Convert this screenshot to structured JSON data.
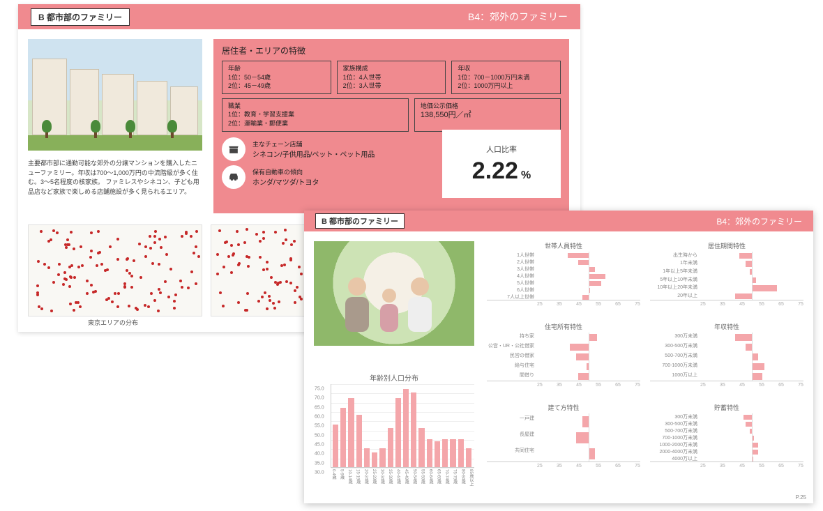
{
  "slide1": {
    "title_box": "B 都市部のファミリー",
    "subtitle": "B4：郊外のファミリー",
    "desc": "主要都市部に通勤可能な郊外の分譲マンションを購入したニューファミリー。年収は700～1,000万円の中流階級が多く住む。3～5名程度の核家族。\nファミレスやシネコン、子ども用品店など家族で楽しめる店舗施設が多く見られるエリア。",
    "features_heading": "居住者・エリアの特徴",
    "age": {
      "label": "年齢",
      "l1": "1位：50－54歳",
      "l2": "2位：45－49歳"
    },
    "family": {
      "label": "家族構成",
      "l1": "1位：4人世帯",
      "l2": "2位：3人世帯"
    },
    "income": {
      "label": "年収",
      "l1": "1位：700－1000万円未満",
      "l2": "2位：1000万円以上"
    },
    "job": {
      "label": "職業",
      "l1": "1位：教育・学習支援業",
      "l2": "2位：運輸業・郵便業"
    },
    "land": {
      "label": "地価公示価格",
      "value": "138,550円／㎡"
    },
    "chain_label": "主なチェーン店舗",
    "chain_value": "シネコン/子供用品/ペット・ペット用品",
    "car_label": "保有自動車の傾向",
    "car_value": "ホンダ/マツダ/トヨタ",
    "pop_label": "人口比率",
    "pop_value": "2.22",
    "pop_unit": "%",
    "map_caption_left": "東京エリアの分布"
  },
  "slide2": {
    "title_box": "B 都市部のファミリー",
    "subtitle": "B4：郊外のファミリー",
    "page": "P.25"
  },
  "chart_data": {
    "age_distribution": {
      "type": "bar",
      "title": "年齢別人口分布",
      "categories": [
        "0-4歳",
        "5-9歳",
        "10-14歳",
        "15-19歳",
        "20-24歳",
        "25-29歳",
        "30-34歳",
        "35-39歳",
        "40-44歳",
        "45-49歳",
        "50-54歳",
        "55-59歳",
        "60-64歳",
        "65-69歳",
        "70-74歳",
        "75-79歳",
        "80-84歳",
        "85歳以上"
      ],
      "values": [
        53,
        62,
        67,
        58,
        40,
        38,
        40,
        51,
        67,
        72,
        70,
        51,
        45,
        44,
        45,
        45,
        45,
        40
      ],
      "ylim": [
        30,
        75
      ],
      "yticks": [
        30,
        35,
        40,
        45,
        50,
        55,
        60,
        65,
        70,
        75
      ]
    },
    "household_size": {
      "type": "bar",
      "orientation": "h",
      "title": "世帯人員特性",
      "categories": [
        "1人世帯",
        "2人世帯",
        "3人世帯",
        "4人世帯",
        "5人世帯",
        "6人世帯",
        "7人以上世帯"
      ],
      "values": [
        40,
        45,
        53,
        58,
        56,
        50,
        47
      ],
      "xlim": [
        25,
        75
      ],
      "xticks": [
        25,
        35,
        45,
        55,
        65,
        75
      ]
    },
    "residence_period": {
      "type": "bar",
      "orientation": "h",
      "title": "居住期間特性",
      "categories": [
        "出生時から",
        "1年未満",
        "1年以上5年未満",
        "5年以上10年未満",
        "10年以上20年未満",
        "20年以上"
      ],
      "values": [
        44,
        47,
        49,
        52,
        62,
        42
      ],
      "xlim": [
        25,
        75
      ],
      "xticks": [
        25,
        35,
        45,
        55,
        65,
        75
      ]
    },
    "ownership": {
      "type": "bar",
      "orientation": "h",
      "title": "住宅所有特性",
      "categories": [
        "持ち家",
        "公営・UR・公社借家",
        "民営の借家",
        "給与住宅",
        "間借り"
      ],
      "values": [
        54,
        41,
        44,
        49,
        45
      ],
      "xlim": [
        25,
        75
      ],
      "xticks": [
        25,
        35,
        45,
        55,
        65,
        75
      ]
    },
    "income": {
      "type": "bar",
      "orientation": "h",
      "title": "年収特性",
      "categories": [
        "300万未満",
        "300-500万未満",
        "500-700万未満",
        "700-1000万未満",
        "1000万以上"
      ],
      "values": [
        42,
        47,
        53,
        56,
        55
      ],
      "xlim": [
        25,
        75
      ],
      "xticks": [
        25,
        35,
        45,
        55,
        65,
        75
      ]
    },
    "building_type": {
      "type": "bar",
      "orientation": "h",
      "title": "建て方特性",
      "categories": [
        "一戸建",
        "長屋建",
        "共同住宅"
      ],
      "values": [
        47,
        44,
        53
      ],
      "xlim": [
        25,
        75
      ],
      "xticks": [
        25,
        35,
        45,
        55,
        65,
        75
      ]
    },
    "savings": {
      "type": "bar",
      "orientation": "h",
      "title": "貯蓄特性",
      "categories": [
        "300万未満",
        "300-500万未満",
        "500-700万未満",
        "700-1000万未満",
        "1000-2000万未満",
        "2000-4000万未満",
        "4000万以上"
      ],
      "values": [
        46,
        47,
        49,
        51,
        53,
        53,
        50
      ],
      "xlim": [
        25,
        75
      ],
      "xticks": [
        25,
        35,
        45,
        55,
        65,
        75
      ]
    }
  }
}
